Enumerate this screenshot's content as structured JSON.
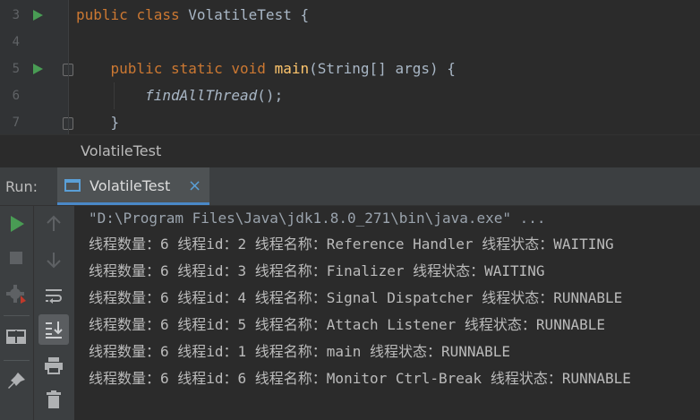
{
  "editor": {
    "lines": [
      {
        "num": "3",
        "tokens": [
          {
            "t": "public ",
            "c": "kw"
          },
          {
            "t": "class ",
            "c": "kw"
          },
          {
            "t": "VolatileTest {",
            "c": ""
          }
        ]
      },
      {
        "num": "4",
        "tokens": []
      },
      {
        "num": "5",
        "tokens": [
          {
            "t": "    public ",
            "c": "kw"
          },
          {
            "t": "static ",
            "c": "kw"
          },
          {
            "t": "void ",
            "c": "kw"
          },
          {
            "t": "main",
            "c": "fn"
          },
          {
            "t": "(String[] args) {",
            "c": ""
          }
        ]
      },
      {
        "num": "6",
        "tokens": [
          {
            "t": "        ",
            "c": ""
          },
          {
            "t": "findAllThread",
            "c": "it"
          },
          {
            "t": "();",
            "c": ""
          }
        ]
      },
      {
        "num": "7",
        "tokens": [
          {
            "t": "    }",
            "c": ""
          }
        ]
      }
    ]
  },
  "breadcrumb": {
    "label": "VolatileTest"
  },
  "run_panel": {
    "label": "Run:",
    "tab_title": "VolatileTest",
    "tab_close": "×",
    "accent": "#4a88c7"
  },
  "console": {
    "command": "\"D:\\Program Files\\Java\\jdk1.8.0_271\\bin\\java.exe\" ...",
    "lines": [
      "线程数量：6 线程id：2 线程名称：Reference Handler 线程状态：WAITING",
      "线程数量：6 线程id：3 线程名称：Finalizer 线程状态：WAITING",
      "线程数量：6 线程id：4 线程名称：Signal Dispatcher 线程状态：RUNNABLE",
      "线程数量：6 线程id：5 线程名称：Attach Listener 线程状态：RUNNABLE",
      "线程数量：6 线程id：1 线程名称：main 线程状态：RUNNABLE",
      "线程数量：6 线程id：6 线程名称：Monitor Ctrl-Break 线程状态：RUNNABLE"
    ]
  },
  "icons": {
    "left_toolbar": [
      "rerun-icon",
      "stop-icon",
      "debug-settings-icon",
      "layout-icon",
      "pin-icon"
    ],
    "right_toolbar": [
      "scroll-up-icon",
      "scroll-down-icon",
      "soft-wrap-icon",
      "scroll-to-end-icon",
      "print-icon",
      "trash-icon"
    ]
  }
}
